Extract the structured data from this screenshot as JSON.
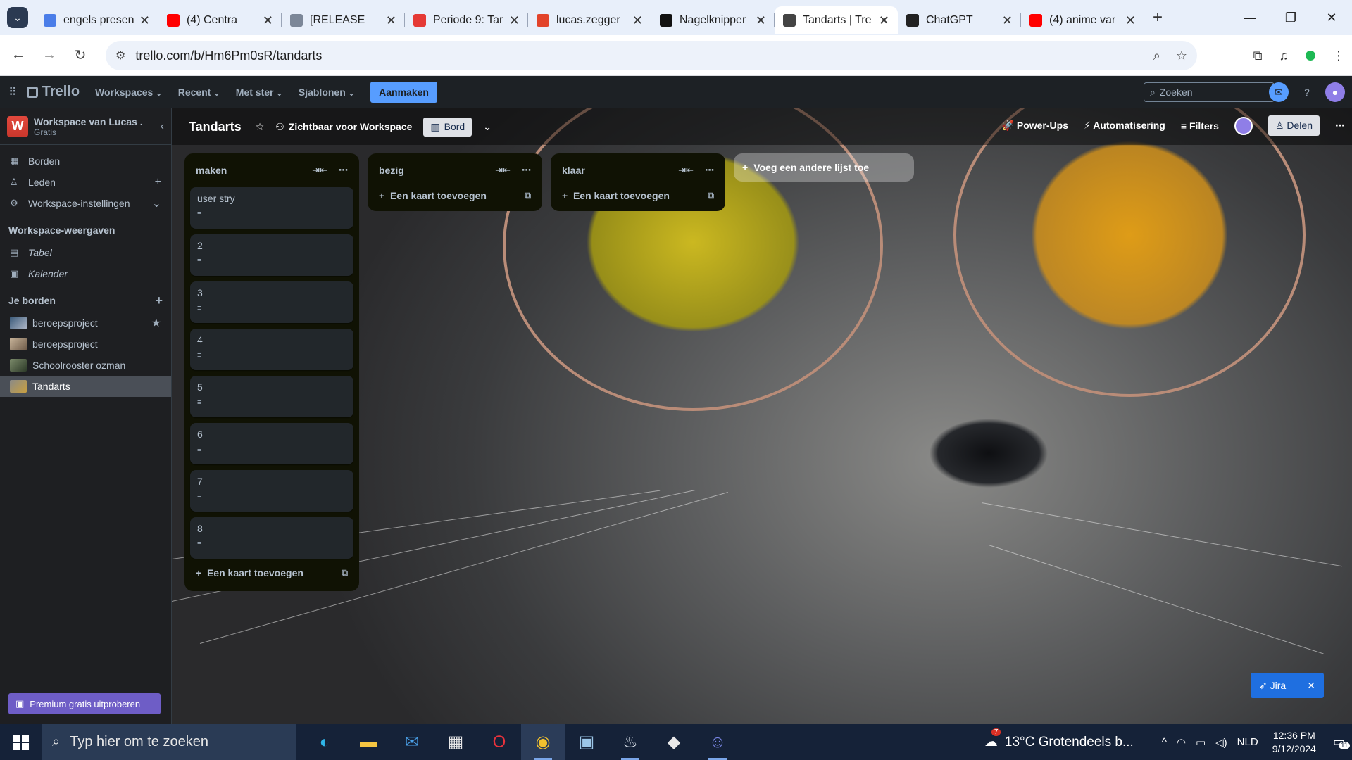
{
  "browser": {
    "tabs": [
      {
        "title": "engels presen",
        "favicon_color": "#4a7de8"
      },
      {
        "title": "(4) Centra",
        "favicon_color": "#ff0000"
      },
      {
        "title": "[RELEASE",
        "favicon_color": "#7c8798"
      },
      {
        "title": "Periode 9: Tar",
        "favicon_color": "#e53935"
      },
      {
        "title": "lucas.zegger",
        "favicon_color": "#e2432a"
      },
      {
        "title": "Nagelknipper",
        "favicon_color": "#111111"
      },
      {
        "title": "Tandarts | Tre",
        "favicon_color": "#444444",
        "active": true
      },
      {
        "title": "ChatGPT",
        "favicon_color": "#222222"
      },
      {
        "title": "(4) anime var",
        "favicon_color": "#ff0000"
      }
    ],
    "url": "trello.com/b/Hm6Pm0sR/tandarts"
  },
  "trello_header": {
    "logo": "Trello",
    "menus": [
      "Workspaces",
      "Recent",
      "Met ster",
      "Sjablonen"
    ],
    "create_label": "Aanmaken",
    "search_placeholder": "Zoeken"
  },
  "sidebar": {
    "workspace_name": "Workspace van Lucas .",
    "workspace_plan": "Gratis",
    "workspace_initial": "W",
    "items": [
      "Borden",
      "Leden",
      "Workspace-instellingen"
    ],
    "views_header": "Workspace-weergaven",
    "views": [
      "Tabel",
      "Kalender"
    ],
    "boards_header": "Je borden",
    "boards": [
      {
        "name": "beroepsproject",
        "starred": true
      },
      {
        "name": "beroepsproject"
      },
      {
        "name": "Schoolrooster ozman"
      },
      {
        "name": "Tandarts",
        "active": true
      }
    ],
    "premium_label": "Premium gratis uitproberen"
  },
  "board": {
    "title": "Tandarts",
    "visibility": "Zichtbaar voor Workspace",
    "view": "Bord",
    "right": {
      "powerups": "Power-Ups",
      "automation": "Automatisering",
      "filters": "Filters",
      "share": "Delen"
    },
    "lists": [
      {
        "title": "maken",
        "cards": [
          "user stry",
          "2",
          "3",
          "4",
          "5",
          "6",
          "7",
          "8"
        ],
        "add_card": "Een kaart toevoegen"
      },
      {
        "title": "bezig",
        "cards": [],
        "add_card": "Een kaart toevoegen"
      },
      {
        "title": "klaar",
        "cards": [],
        "add_card": "Een kaart toevoegen"
      }
    ],
    "add_list": "Voeg een andere lijst toe",
    "jira_label": "Jira"
  },
  "taskbar": {
    "search_placeholder": "Typ hier om te zoeken",
    "weather": "13°C  Grotendeels b...",
    "weather_badge": "7",
    "language": "NLD",
    "time": "12:36 PM",
    "date": "9/12/2024",
    "notif_count": "11"
  }
}
